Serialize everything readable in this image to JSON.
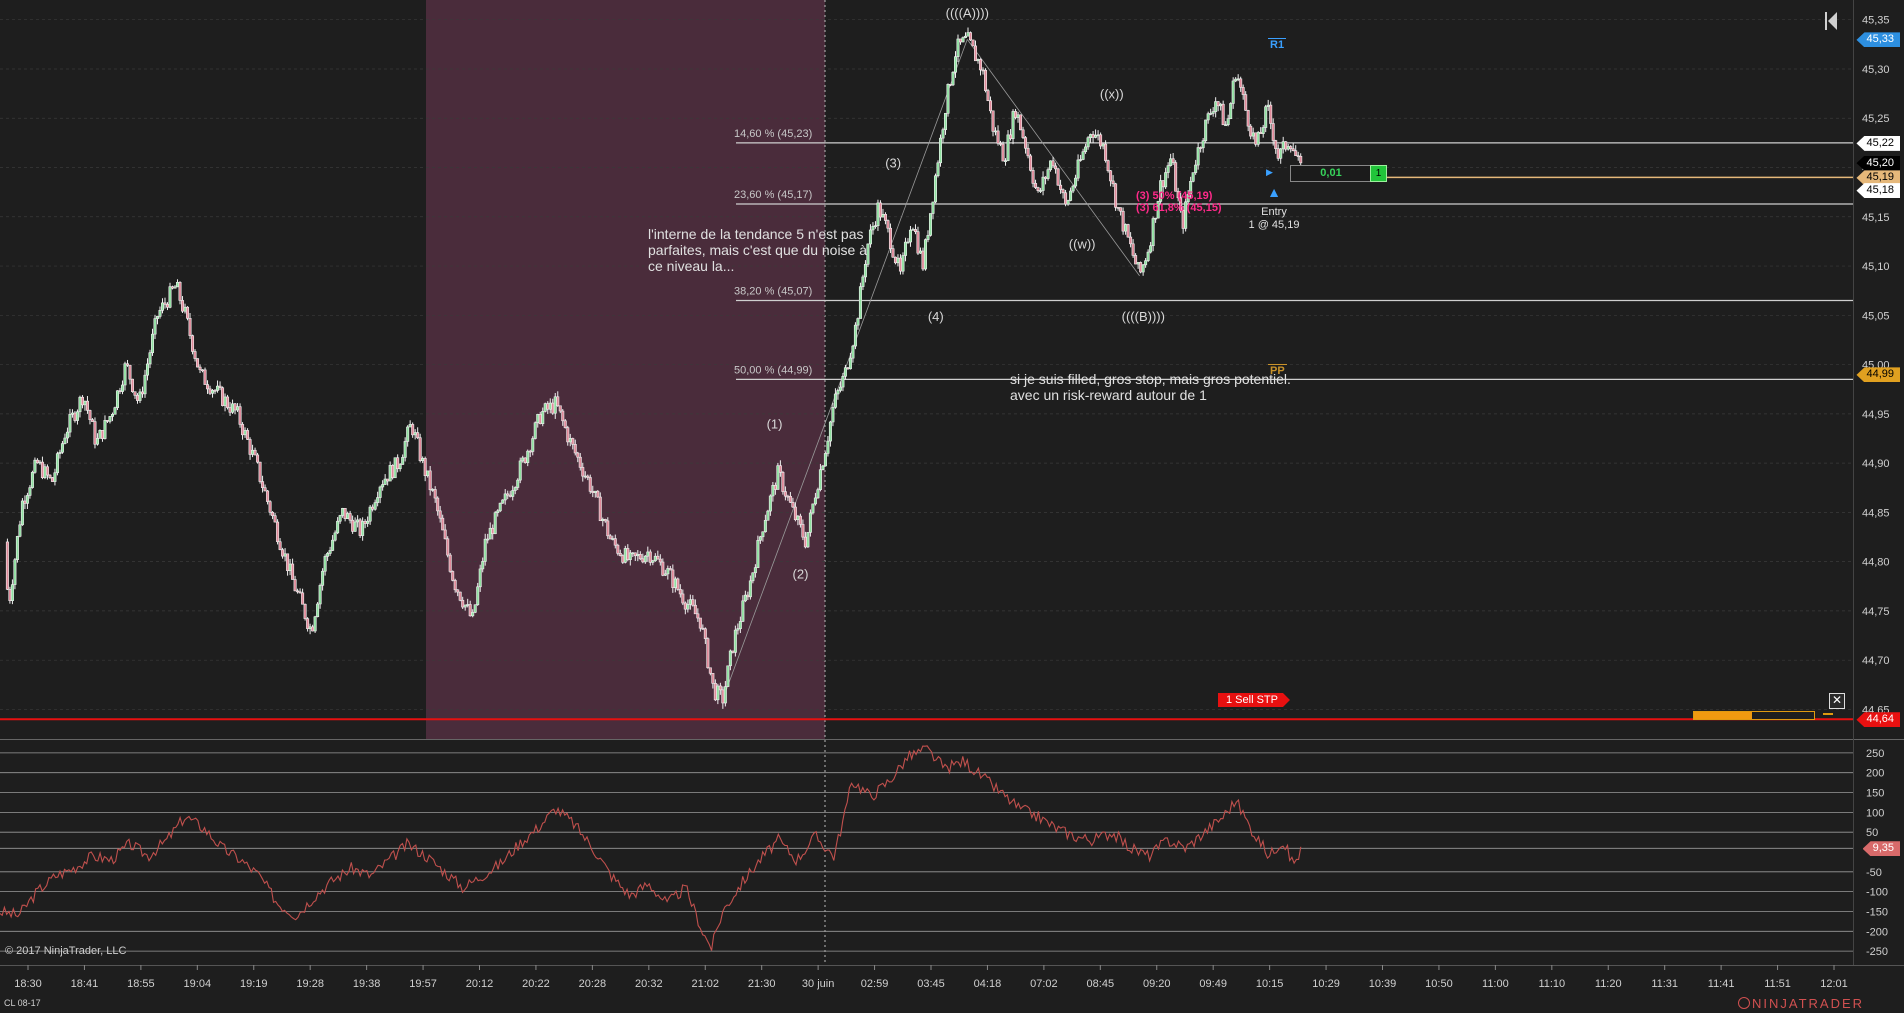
{
  "colors": {
    "background": "#1e1e1e",
    "session_shade": "#4a2c3b",
    "grid": "#3a3a3a",
    "stop_line": "#e81010",
    "entry_line": "#e6b87a",
    "fib_line": "#cfcfcf",
    "candle_up": "#8fe0a0",
    "candle_down": "#e08a9a",
    "candle_outline": "#f0f0f0",
    "oscillator": "#c0504d",
    "r1": "#3aa0ff",
    "pp": "#c8922a",
    "fib_magenta": "#ff2a8a"
  },
  "price_axis": {
    "min": 44.62,
    "max": 45.37,
    "labels": [
      "45,35",
      "45,30",
      "45,25",
      "45,20",
      "45,15",
      "45,10",
      "45,05",
      "45,00",
      "44,95",
      "44,90",
      "44,85",
      "44,80",
      "44,75",
      "44,70",
      "44,65"
    ],
    "values": [
      45.35,
      45.3,
      45.25,
      45.2,
      45.15,
      45.1,
      45.05,
      45.0,
      44.95,
      44.9,
      44.85,
      44.8,
      44.75,
      44.7,
      44.65
    ],
    "tags": [
      {
        "text": "45,33",
        "value": 45.33,
        "bg": "#2d8fe0",
        "fg": "#ffffff"
      },
      {
        "text": "45,22",
        "value": 45.225,
        "bg": "#ffffff",
        "fg": "#000000"
      },
      {
        "text": "45,20",
        "value": 45.205,
        "bg": "#000000",
        "fg": "#ffffff"
      },
      {
        "text": "45,19",
        "value": 45.19,
        "bg": "#e6b87a",
        "fg": "#000000"
      },
      {
        "text": "45,18",
        "value": 45.177,
        "bg": "#ffffff",
        "fg": "#000000"
      },
      {
        "text": "44,99",
        "value": 44.99,
        "bg": "#e0a020",
        "fg": "#000000"
      },
      {
        "text": "44,64",
        "value": 44.64,
        "bg": "#e81010",
        "fg": "#ffffff"
      }
    ]
  },
  "time_axis": {
    "labels": [
      "18:30",
      "18:41",
      "18:55",
      "19:04",
      "19:19",
      "19:28",
      "19:38",
      "19:57",
      "20:12",
      "20:22",
      "20:28",
      "20:32",
      "21:02",
      "21:30",
      "30 juin",
      "02:59",
      "03:45",
      "04:18",
      "07:02",
      "08:45",
      "09:20",
      "09:49",
      "10:15",
      "10:29",
      "10:39",
      "10:50",
      "11:00",
      "11:10",
      "11:20",
      "11:31",
      "11:41",
      "11:51",
      "12:01"
    ]
  },
  "fib_levels": [
    {
      "label": "14,60 % (45,23)",
      "value": 45.225
    },
    {
      "label": "23,60 % (45,17)",
      "value": 45.163
    },
    {
      "label": "38,20 % (45,07)",
      "value": 45.065
    },
    {
      "label": "50,00 % (44,99)",
      "value": 44.985
    }
  ],
  "wave_labels": [
    {
      "text": "((((A))))",
      "t": 0.522,
      "p": 45.352
    },
    {
      "text": "((x))",
      "t": 0.6,
      "p": 45.27
    },
    {
      "text": "((w))",
      "t": 0.584,
      "p": 45.118
    },
    {
      "text": "((((B))))",
      "t": 0.617,
      "p": 45.044
    },
    {
      "text": "(3)",
      "t": 0.482,
      "p": 45.2
    },
    {
      "text": "(4)",
      "t": 0.505,
      "p": 45.044
    },
    {
      "text": "(1)",
      "t": 0.418,
      "p": 44.935
    },
    {
      "text": "(2)",
      "t": 0.432,
      "p": 44.783
    }
  ],
  "annotations": {
    "note1_line1": "l'interne de la tendance 5 n'est pas",
    "note1_line2": "parfaites, mais c'est que du noise à",
    "note1_line3": "ce niveau la...",
    "note2_line1": "si je suis filled, gros stop, mais gros potentiel.",
    "note2_line2": "avec un risk-reward autour de 1",
    "entry_title": "Entry",
    "entry_detail": "1 @ 45,19",
    "r1": "R1",
    "pp": "PP",
    "fib_small_1": "(3) 50% (45,19)",
    "fib_small_2": "(3) 61,8% (45,15)"
  },
  "order": {
    "entry_price_value": 45.19,
    "pnl_text": "0,01",
    "qty": "1",
    "stop_value": 44.64,
    "stop_label": "1  Sell STP"
  },
  "oscillator": {
    "labels": [
      "250",
      "200",
      "150",
      "100",
      "50",
      "9,35",
      "-50",
      "-100",
      "-150",
      "-200",
      "-250"
    ],
    "values": [
      250,
      200,
      150,
      100,
      50,
      9.35,
      -50,
      -100,
      -150,
      -200,
      -250
    ],
    "current_text": "9,35",
    "current_value": 9.35,
    "min": -285,
    "max": 285
  },
  "footer": {
    "copyright": "© 2017 NinjaTrader, LLC",
    "instrument": "CL 08-17",
    "brand": "NINJATRADER"
  },
  "price_path": [
    [
      0,
      44.82
    ],
    [
      0.005,
      44.76
    ],
    [
      0.012,
      44.86
    ],
    [
      0.02,
      44.9
    ],
    [
      0.028,
      44.88
    ],
    [
      0.035,
      44.93
    ],
    [
      0.045,
      44.97
    ],
    [
      0.052,
      44.92
    ],
    [
      0.06,
      44.95
    ],
    [
      0.068,
      45.0
    ],
    [
      0.075,
      44.96
    ],
    [
      0.085,
      45.05
    ],
    [
      0.095,
      45.08
    ],
    [
      0.1,
      45.05
    ],
    [
      0.108,
      44.99
    ],
    [
      0.118,
      44.97
    ],
    [
      0.128,
      44.95
    ],
    [
      0.138,
      44.9
    ],
    [
      0.148,
      44.84
    ],
    [
      0.158,
      44.78
    ],
    [
      0.168,
      44.73
    ],
    [
      0.175,
      44.8
    ],
    [
      0.185,
      44.85
    ],
    [
      0.195,
      44.83
    ],
    [
      0.205,
      44.88
    ],
    [
      0.215,
      44.9
    ],
    [
      0.222,
      44.94
    ],
    [
      0.228,
      44.9
    ],
    [
      0.235,
      44.86
    ],
    [
      0.245,
      44.78
    ],
    [
      0.255,
      44.74
    ],
    [
      0.262,
      44.82
    ],
    [
      0.272,
      44.86
    ],
    [
      0.282,
      44.9
    ],
    [
      0.292,
      44.95
    ],
    [
      0.3,
      44.96
    ],
    [
      0.308,
      44.92
    ],
    [
      0.318,
      44.88
    ],
    [
      0.33,
      44.82
    ],
    [
      0.34,
      44.8
    ],
    [
      0.35,
      44.81
    ],
    [
      0.36,
      44.79
    ],
    [
      0.37,
      44.76
    ],
    [
      0.378,
      44.74
    ],
    [
      0.385,
      44.67
    ],
    [
      0.39,
      44.66
    ],
    [
      0.396,
      44.72
    ],
    [
      0.405,
      44.78
    ],
    [
      0.412,
      44.84
    ],
    [
      0.42,
      44.89
    ],
    [
      0.428,
      44.85
    ],
    [
      0.435,
      44.82
    ],
    [
      0.44,
      44.87
    ],
    [
      0.446,
      44.92
    ],
    [
      0.45,
      44.96
    ],
    [
      0.456,
      44.99
    ],
    [
      0.462,
      45.04
    ],
    [
      0.468,
      45.12
    ],
    [
      0.474,
      45.16
    ],
    [
      0.48,
      45.13
    ],
    [
      0.486,
      45.09
    ],
    [
      0.492,
      45.15
    ],
    [
      0.498,
      45.1
    ],
    [
      0.504,
      45.18
    ],
    [
      0.51,
      45.26
    ],
    [
      0.516,
      45.32
    ],
    [
      0.522,
      45.33
    ],
    [
      0.53,
      45.3
    ],
    [
      0.536,
      45.24
    ],
    [
      0.542,
      45.21
    ],
    [
      0.548,
      45.26
    ],
    [
      0.554,
      45.22
    ],
    [
      0.56,
      45.17
    ],
    [
      0.568,
      45.21
    ],
    [
      0.575,
      45.16
    ],
    [
      0.582,
      45.2
    ],
    [
      0.589,
      45.24
    ],
    [
      0.596,
      45.22
    ],
    [
      0.603,
      45.16
    ],
    [
      0.61,
      45.12
    ],
    [
      0.615,
      45.09
    ],
    [
      0.62,
      45.12
    ],
    [
      0.626,
      45.18
    ],
    [
      0.632,
      45.21
    ],
    [
      0.638,
      45.14
    ],
    [
      0.644,
      45.2
    ],
    [
      0.65,
      45.24
    ],
    [
      0.656,
      45.27
    ],
    [
      0.662,
      45.24
    ],
    [
      0.667,
      45.3
    ],
    [
      0.672,
      45.26
    ],
    [
      0.678,
      45.22
    ],
    [
      0.684,
      45.26
    ],
    [
      0.69,
      45.21
    ],
    [
      0.696,
      45.23
    ],
    [
      0.703,
      45.19
    ]
  ],
  "osc_path": [
    [
      0,
      -150
    ],
    [
      0.01,
      -160
    ],
    [
      0.02,
      -100
    ],
    [
      0.03,
      -60
    ],
    [
      0.04,
      -40
    ],
    [
      0.05,
      -10
    ],
    [
      0.06,
      -20
    ],
    [
      0.07,
      20
    ],
    [
      0.08,
      -10
    ],
    [
      0.09,
      30
    ],
    [
      0.1,
      90
    ],
    [
      0.11,
      60
    ],
    [
      0.12,
      10
    ],
    [
      0.13,
      -20
    ],
    [
      0.14,
      -60
    ],
    [
      0.15,
      -130
    ],
    [
      0.16,
      -160
    ],
    [
      0.17,
      -110
    ],
    [
      0.18,
      -70
    ],
    [
      0.19,
      -40
    ],
    [
      0.2,
      -60
    ],
    [
      0.21,
      -20
    ],
    [
      0.22,
      20
    ],
    [
      0.23,
      -10
    ],
    [
      0.24,
      -50
    ],
    [
      0.25,
      -90
    ],
    [
      0.26,
      -60
    ],
    [
      0.27,
      -30
    ],
    [
      0.28,
      20
    ],
    [
      0.29,
      60
    ],
    [
      0.3,
      110
    ],
    [
      0.31,
      70
    ],
    [
      0.32,
      10
    ],
    [
      0.33,
      -60
    ],
    [
      0.34,
      -110
    ],
    [
      0.35,
      -80
    ],
    [
      0.36,
      -130
    ],
    [
      0.37,
      -90
    ],
    [
      0.38,
      -210
    ],
    [
      0.384,
      -240
    ],
    [
      0.39,
      -150
    ],
    [
      0.4,
      -80
    ],
    [
      0.41,
      -20
    ],
    [
      0.42,
      30
    ],
    [
      0.43,
      -20
    ],
    [
      0.44,
      40
    ],
    [
      0.45,
      -10
    ],
    [
      0.455,
      80
    ],
    [
      0.46,
      180
    ],
    [
      0.47,
      140
    ],
    [
      0.48,
      180
    ],
    [
      0.49,
      240
    ],
    [
      0.5,
      260
    ],
    [
      0.51,
      210
    ],
    [
      0.52,
      230
    ],
    [
      0.53,
      190
    ],
    [
      0.54,
      150
    ],
    [
      0.55,
      110
    ],
    [
      0.56,
      90
    ],
    [
      0.57,
      60
    ],
    [
      0.58,
      40
    ],
    [
      0.59,
      30
    ],
    [
      0.6,
      50
    ],
    [
      0.61,
      10
    ],
    [
      0.62,
      -10
    ],
    [
      0.63,
      30
    ],
    [
      0.64,
      10
    ],
    [
      0.65,
      50
    ],
    [
      0.66,
      90
    ],
    [
      0.667,
      130
    ],
    [
      0.675,
      60
    ],
    [
      0.685,
      -10
    ],
    [
      0.692,
      30
    ],
    [
      0.698,
      -30
    ],
    [
      0.703,
      10
    ]
  ]
}
